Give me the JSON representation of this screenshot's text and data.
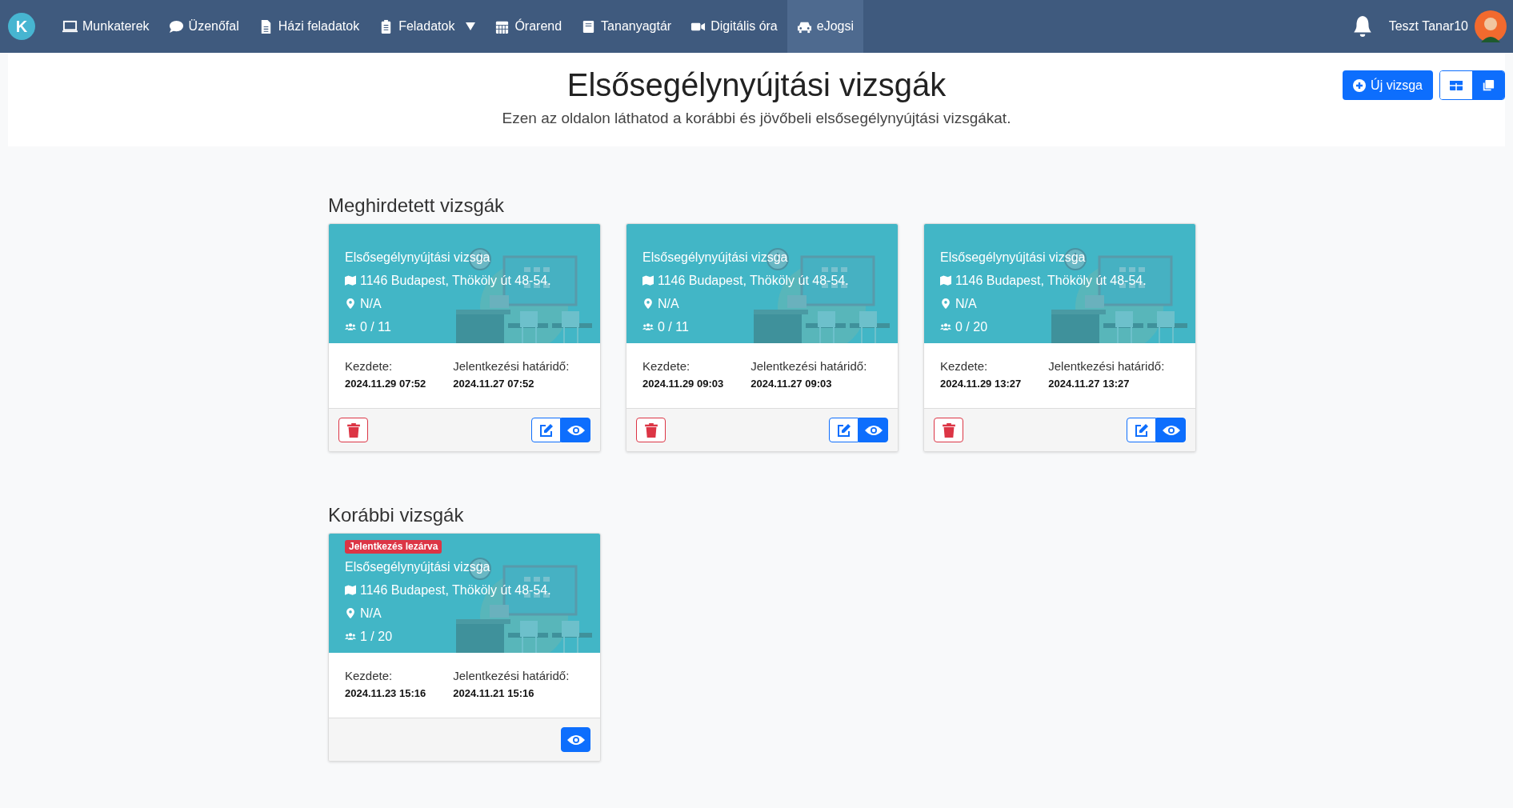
{
  "navbar": {
    "logo": "K",
    "items": [
      {
        "label": "Munkaterek",
        "selected": false,
        "dropdown": false
      },
      {
        "label": "Üzenőfal",
        "selected": false,
        "dropdown": false
      },
      {
        "label": "Házi feladatok",
        "selected": false,
        "dropdown": false
      },
      {
        "label": "Feladatok",
        "selected": false,
        "dropdown": true
      },
      {
        "label": "Órarend",
        "selected": false,
        "dropdown": false
      },
      {
        "label": "Tananyagtár",
        "selected": false,
        "dropdown": false
      },
      {
        "label": "Digitális óra",
        "selected": false,
        "dropdown": false
      },
      {
        "label": "eJogsi",
        "selected": true,
        "dropdown": false
      }
    ],
    "user": "Teszt Tanar10"
  },
  "header": {
    "title": "Elsősegélynyújtási vizsgák",
    "subtitle": "Ezen az oldalon láthatod a korábbi és jövőbeli elsősegélynyújtási vizsgákat.",
    "new_button": "Új vizsga",
    "views": [
      {
        "kind": "table",
        "selected": false
      },
      {
        "kind": "cards",
        "selected": true
      }
    ]
  },
  "sections": [
    {
      "title": "Meghirdetett vizsgák",
      "cards": [
        {
          "title": "Elsősegélynyújtási vizsga",
          "address": "1146 Budapest, Thököly út 48-54.",
          "room": "N/A",
          "participants": "0 / 11",
          "start_label": "Kezdete:",
          "start": "2024.11.29 07:52",
          "deadline_label": "Jelentkezési határidő:",
          "deadline": "2024.11.27 07:52",
          "actions": [
            {
              "kind": "delete"
            },
            {
              "kind": "edit"
            },
            {
              "kind": "view"
            }
          ]
        },
        {
          "title": "Elsősegélynyújtási vizsga",
          "address": "1146 Budapest, Thököly út 48-54.",
          "room": "N/A",
          "participants": "0 / 11",
          "start_label": "Kezdete:",
          "start": "2024.11.29 09:03",
          "deadline_label": "Jelentkezési határidő:",
          "deadline": "2024.11.27 09:03",
          "actions": [
            {
              "kind": "delete"
            },
            {
              "kind": "edit"
            },
            {
              "kind": "view"
            }
          ]
        },
        {
          "title": "Elsősegélynyújtási vizsga",
          "address": "1146 Budapest, Thököly út 48-54.",
          "room": "N/A",
          "participants": "0 / 20",
          "start_label": "Kezdete:",
          "start": "2024.11.29 13:27",
          "deadline_label": "Jelentkezési határidő:",
          "deadline": "2024.11.27 13:27",
          "actions": [
            {
              "kind": "delete"
            },
            {
              "kind": "edit"
            },
            {
              "kind": "view"
            }
          ]
        }
      ]
    },
    {
      "title": "Korábbi vizsgák",
      "cards": [
        {
          "badge": "Jelentkezés lezárva",
          "title": "Elsősegélynyújtási vizsga",
          "address": "1146 Budapest, Thököly út 48-54.",
          "room": "N/A",
          "participants": "1 / 20",
          "start_label": "Kezdete:",
          "start": "2024.11.23 15:16",
          "deadline_label": "Jelentkezési határidő:",
          "deadline": "2024.11.21 15:16",
          "actions": [
            {
              "kind": "view"
            }
          ]
        }
      ]
    }
  ]
}
